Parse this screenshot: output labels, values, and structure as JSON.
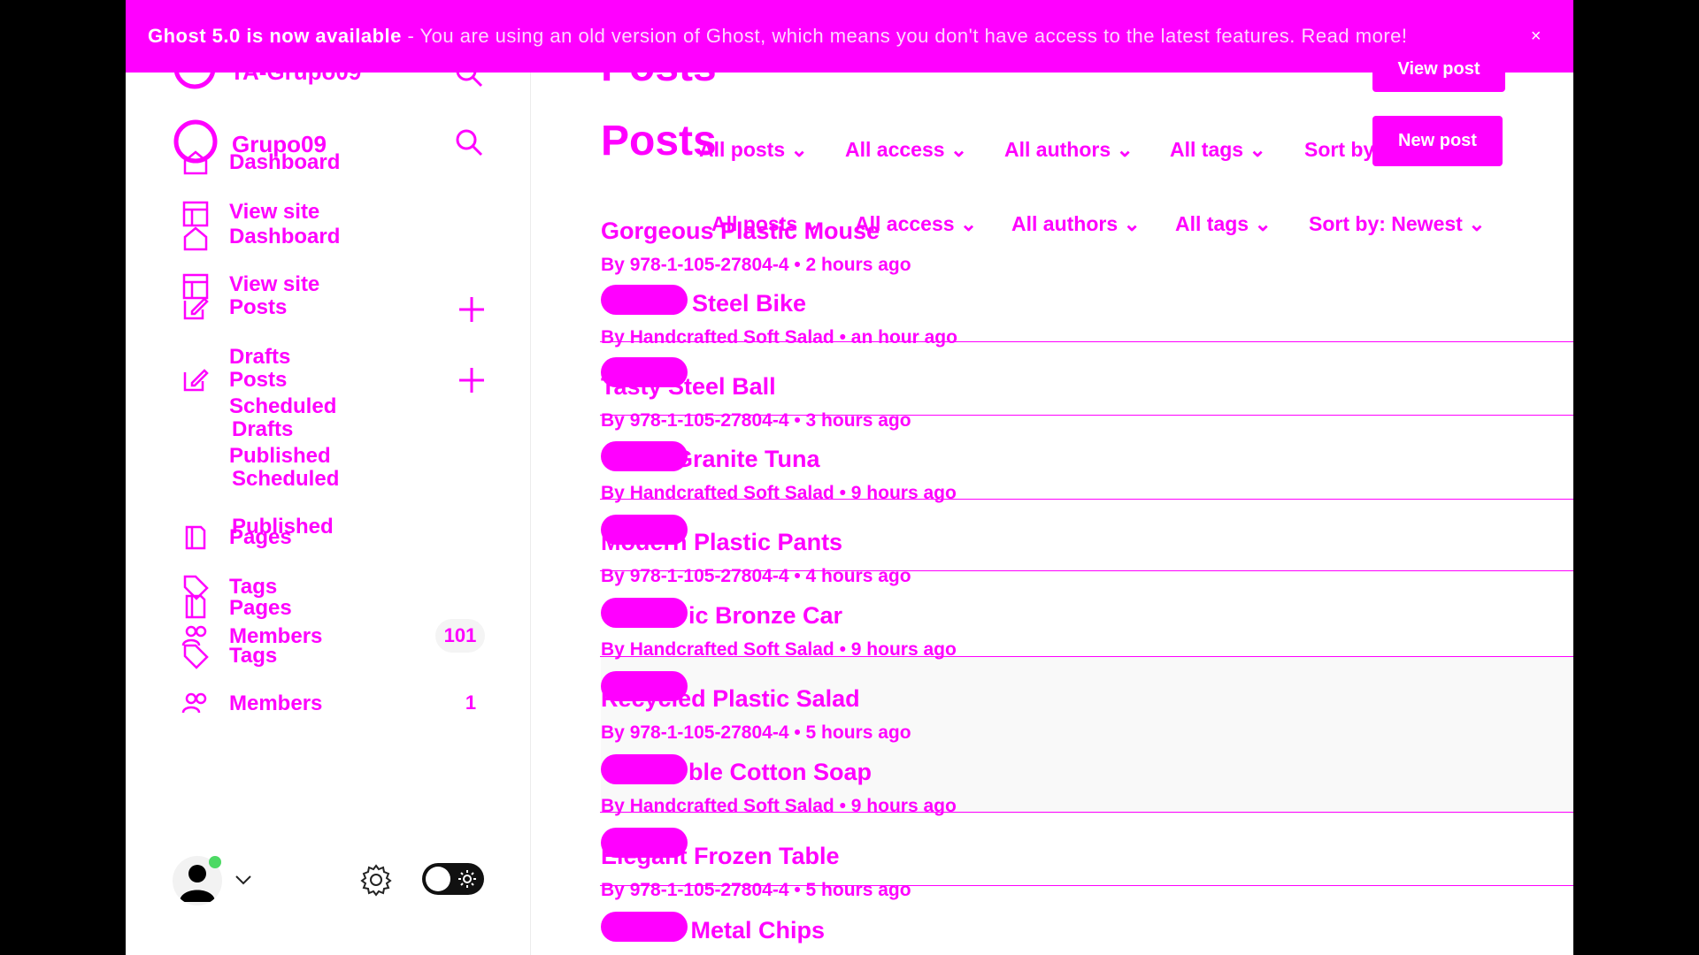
{
  "banner": {
    "title": "Ghost 5.0 is now available",
    "message": " - You are using an old version of Ghost, which means you don't have access to the latest features.",
    "link": "Read more!",
    "close": "×"
  },
  "site": {
    "name": "Grupo09",
    "ghost_name": "TA-Grupo09"
  },
  "sidebar": {
    "items": [
      {
        "label": "Dashboard"
      },
      {
        "label": "View site"
      },
      {
        "label": "Posts"
      },
      {
        "label": "Drafts"
      },
      {
        "label": "Scheduled"
      },
      {
        "label": "Published"
      },
      {
        "label": "Pages"
      },
      {
        "label": "Tags"
      },
      {
        "label": "Members"
      }
    ],
    "members_count_a": "101",
    "members_count_b": "1"
  },
  "main": {
    "page_title": "Posts",
    "new_post_label": "New post",
    "view_post_label": "View post",
    "filters": {
      "posts": "All posts",
      "access": "All access",
      "authors": "All authors",
      "tags": "All tags",
      "sort": "Sort by: Newest",
      "sort_short": "Sort by"
    }
  },
  "posts": [
    {
      "title": "Gorgeous Plastic Mouse",
      "by": "By",
      "author": "978-1-105-27804-4",
      "time": "2 hours ago"
    },
    {
      "title": "Steel Bike",
      "by": "By",
      "author": "Handcrafted Soft Salad",
      "time": "an hour ago"
    },
    {
      "title": "Tasty Steel Ball",
      "by": "By",
      "author": "978-1-105-27804-4",
      "time": "3 hours ago"
    },
    {
      "title": "Granite Tuna",
      "by": "By",
      "author": "Handcrafted Soft Salad",
      "time": "9 hours ago"
    },
    {
      "title": "Modern Plastic Pants",
      "by": "By",
      "author": "978-1-105-27804-4",
      "time": "4 hours ago"
    },
    {
      "title": "ic Bronze Car",
      "by": "By",
      "author": "Handcrafted Soft Salad",
      "time": "9 hours ago"
    },
    {
      "title": "Recycled Plastic Salad",
      "by": "By",
      "author": "978-1-105-27804-4",
      "time": "5 hours ago"
    },
    {
      "title": "ble Cotton Soap",
      "by": "By",
      "author": "Handcrafted Soft Salad",
      "time": "9 hours ago"
    },
    {
      "title": "Elegant Frozen Table",
      "by": "By",
      "author": "978-1-105-27804-4",
      "time": "5 hours ago"
    },
    {
      "title": "c Metal Chips",
      "by": "By",
      "author": "",
      "time": ""
    }
  ],
  "colors": {
    "accent": "#ff00ff",
    "background": "#ffffff",
    "frame": "#000000",
    "status_online": "#4cd964"
  }
}
